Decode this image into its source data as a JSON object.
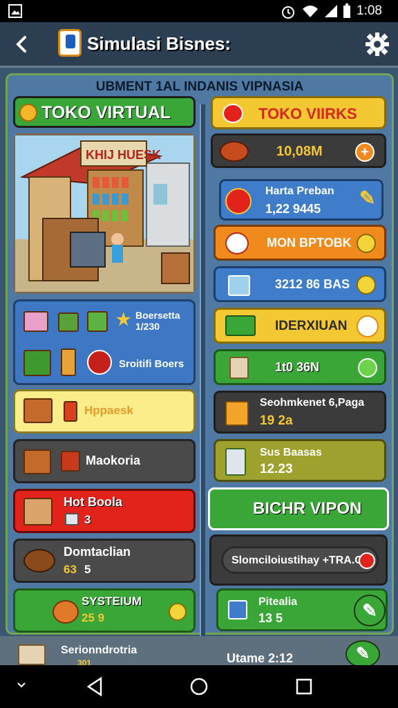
{
  "status_bar": {
    "time": "1:08",
    "icons": [
      "image-icon",
      "alarm-icon",
      "wifi-icon",
      "signal-icon",
      "battery-icon"
    ]
  },
  "header": {
    "title": "Simulasi Bisnes:",
    "back_icon": "back-arrow-icon",
    "settings_icon": "gear-icon"
  },
  "board": {
    "banner": "UBMENT 1AL INDANIS VIPNASIA"
  },
  "left": {
    "toko_title": "TOKO VIRTUAL",
    "shop_sign": "KHIJ HUESK",
    "inventory": {
      "label1": "Boersetta",
      "value1": "1/230",
      "label2": "Sroitifi Boers"
    },
    "rows": [
      {
        "name": "row-produk",
        "label": "Hppaesk",
        "value": ""
      },
      {
        "name": "row-makoria",
        "label": "Maokoria",
        "value": ""
      },
      {
        "name": "row-hot-boola",
        "label": "Hot Boola",
        "value": "3"
      },
      {
        "name": "row-domtaclian",
        "label": "Domtaclian",
        "value": "5"
      }
    ],
    "row4_value_prefix": "63",
    "system_label": "SYSTEIUM",
    "system_value": "25 9"
  },
  "right": {
    "vibes_title": "TOKO VIIRKS",
    "money_value": "10,08M",
    "stats": [
      {
        "label": "Harta Preban",
        "value": "1,22 9445"
      },
      {
        "label": "MON BPTOBK",
        "value": ""
      },
      {
        "label": "3212 86 BAS",
        "value": ""
      },
      {
        "label": "IDERXIUAN",
        "value": ""
      },
      {
        "label": "1t0 36N",
        "value": ""
      }
    ],
    "seohm_label": "Seohmkenet 6,Paga",
    "seohm_value": "19 2a",
    "sus_label": "Sus Baasas",
    "sus_value": "12.23",
    "big_button": "BICHR VIPON",
    "slom_button": "Slomciloiustihay +TRA.G",
    "pitealia_label": "Pitealia",
    "pitealia_value": "13 5"
  },
  "bottom": {
    "left_label": "Serionndrotria",
    "left_value": "301",
    "right_label": "Utame 2:12"
  },
  "colors": {
    "green": "#3aa637",
    "yellow": "#f3c833",
    "orange": "#f08a1c",
    "blue": "#3f7cc9",
    "red": "#d9241e",
    "dark": "#4a4a4a",
    "olive": "#9ea12d"
  }
}
